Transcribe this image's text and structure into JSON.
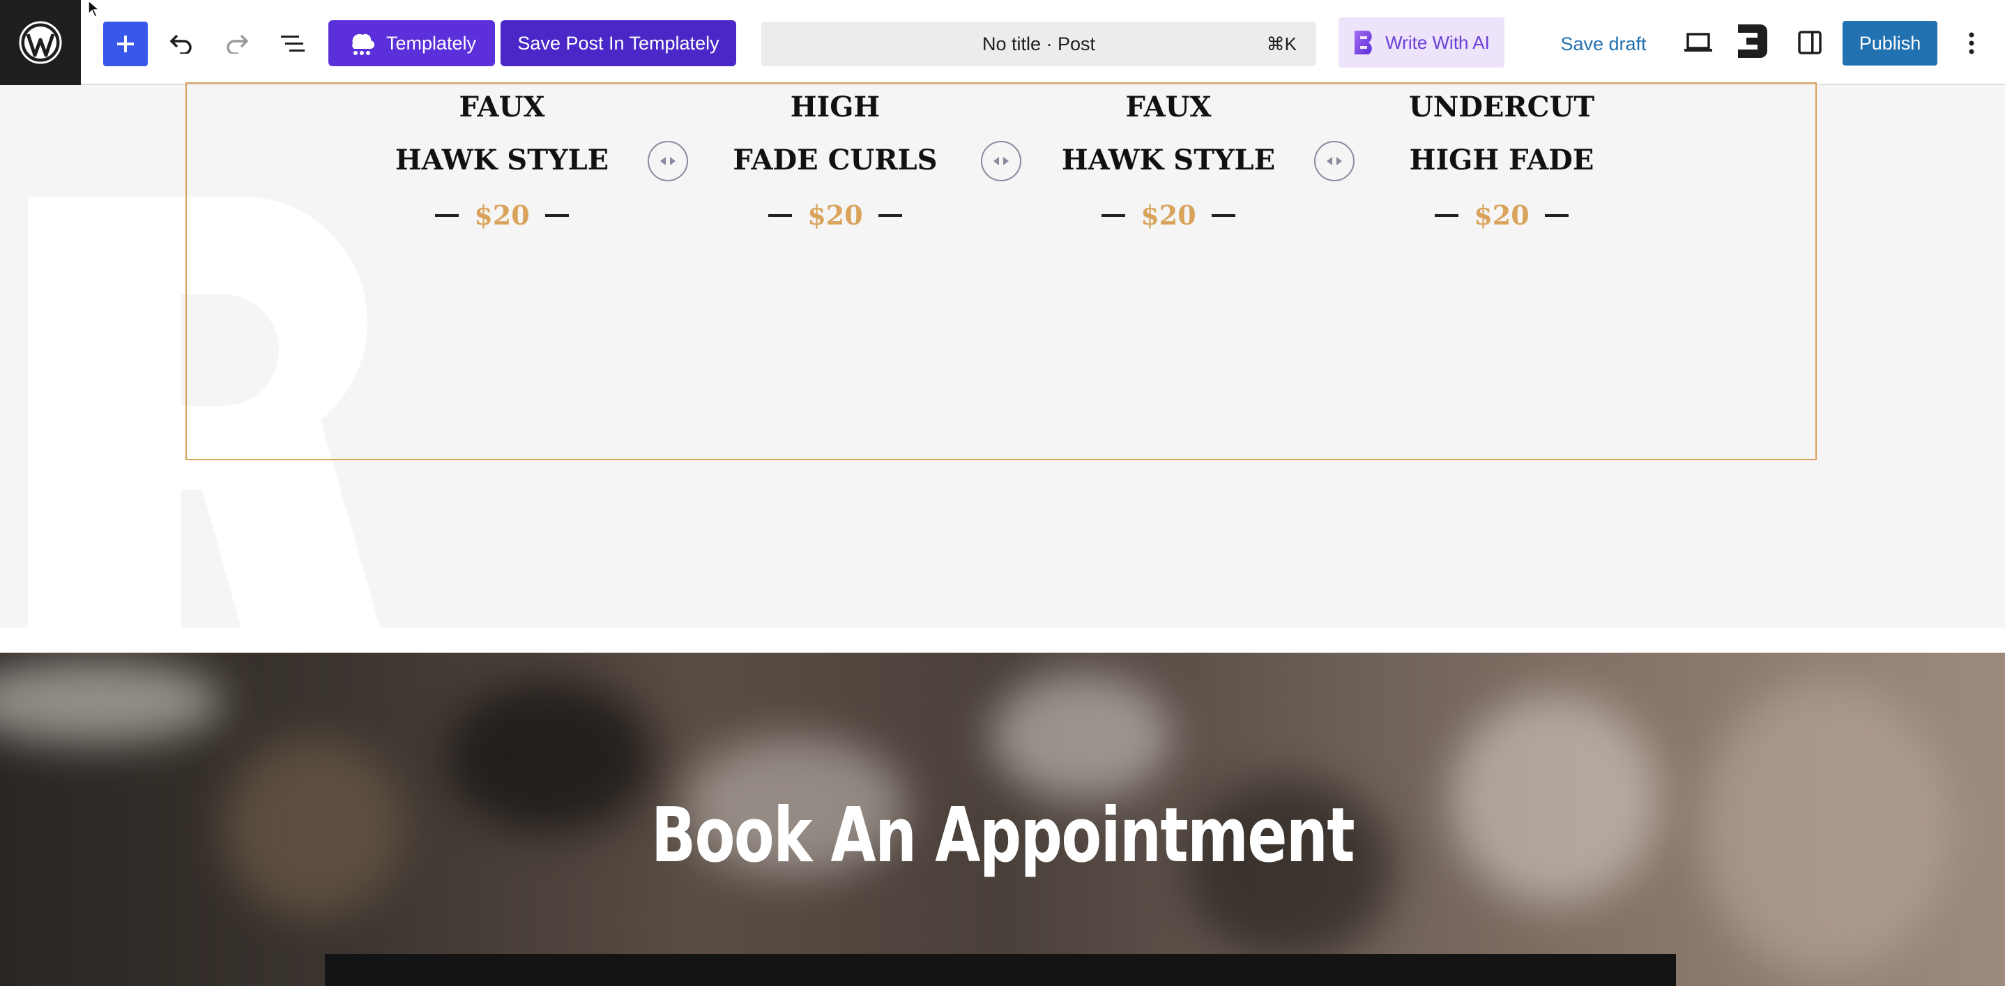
{
  "toolbar": {
    "templately_label": "Templately",
    "save_templately_label": "Save Post In Templately",
    "document_title": "No title · Post",
    "shortcut": "⌘K",
    "ai_label": "Write With AI",
    "save_draft_label": "Save draft",
    "publish_label": "Publish"
  },
  "pricing": {
    "services": [
      {
        "line1": "FAUX",
        "line2": "HAWK STYLE",
        "price": "$20"
      },
      {
        "line1": "HIGH",
        "line2": "FADE CURLS",
        "price": "$20"
      },
      {
        "line1": "FAUX",
        "line2": "HAWK STYLE",
        "price": "$20"
      },
      {
        "line1": "UNDERCUT",
        "line2": "HIGH FADE",
        "price": "$20"
      }
    ]
  },
  "appointment": {
    "title": "Book An Appointment"
  },
  "colors": {
    "wp_admin_blue": "#2271b1",
    "add_button_blue": "#3858e9",
    "templately_purple": "#5b2fd9",
    "accent_gold": "#d9a35c"
  },
  "icons": [
    "wordpress-logo-icon",
    "plus-icon",
    "undo-icon",
    "redo-icon",
    "document-overview-icon",
    "templately-icon",
    "ai-logo-icon",
    "desktop-preview-icon",
    "elementor-e-icon",
    "sidebar-toggle-icon",
    "more-options-icon",
    "resize-handle-icon"
  ]
}
